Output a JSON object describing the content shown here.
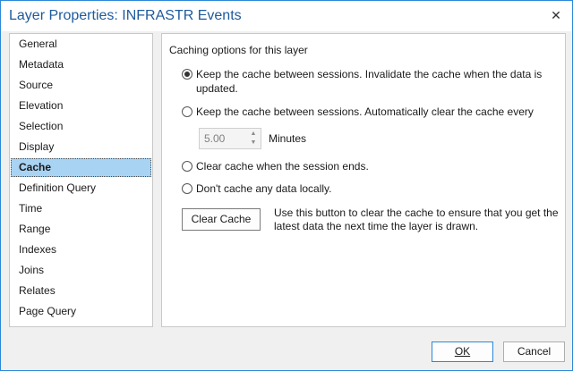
{
  "window": {
    "title": "Layer Properties: INFRASTR Events",
    "close_glyph": "✕"
  },
  "sidebar": {
    "items": [
      {
        "label": "General"
      },
      {
        "label": "Metadata"
      },
      {
        "label": "Source"
      },
      {
        "label": "Elevation"
      },
      {
        "label": "Selection"
      },
      {
        "label": "Display"
      },
      {
        "label": "Cache",
        "selected": true
      },
      {
        "label": "Definition Query"
      },
      {
        "label": "Time"
      },
      {
        "label": "Range"
      },
      {
        "label": "Indexes"
      },
      {
        "label": "Joins"
      },
      {
        "label": "Relates"
      },
      {
        "label": "Page Query"
      }
    ]
  },
  "cache": {
    "heading": "Caching options for this layer",
    "options": [
      {
        "label": "Keep the cache between sessions. Invalidate the cache when the data is updated.",
        "checked": true
      },
      {
        "label": "Keep the cache between sessions. Automatically clear the cache every",
        "checked": false
      },
      {
        "label": "Clear cache when the session ends.",
        "checked": false
      },
      {
        "label": "Don't cache any data locally.",
        "checked": false
      }
    ],
    "interval_value": "5.00",
    "interval_unit": "Minutes",
    "clear_button_label": "Clear Cache",
    "clear_help_text": "Use this button to clear the cache to ensure that you get the latest data the next time the layer is drawn."
  },
  "footer": {
    "ok_label": "OK",
    "cancel_label": "Cancel"
  },
  "colors": {
    "accent": "#2b88d8",
    "title_text": "#1e5a9c",
    "selection": "#a9d3f3"
  }
}
